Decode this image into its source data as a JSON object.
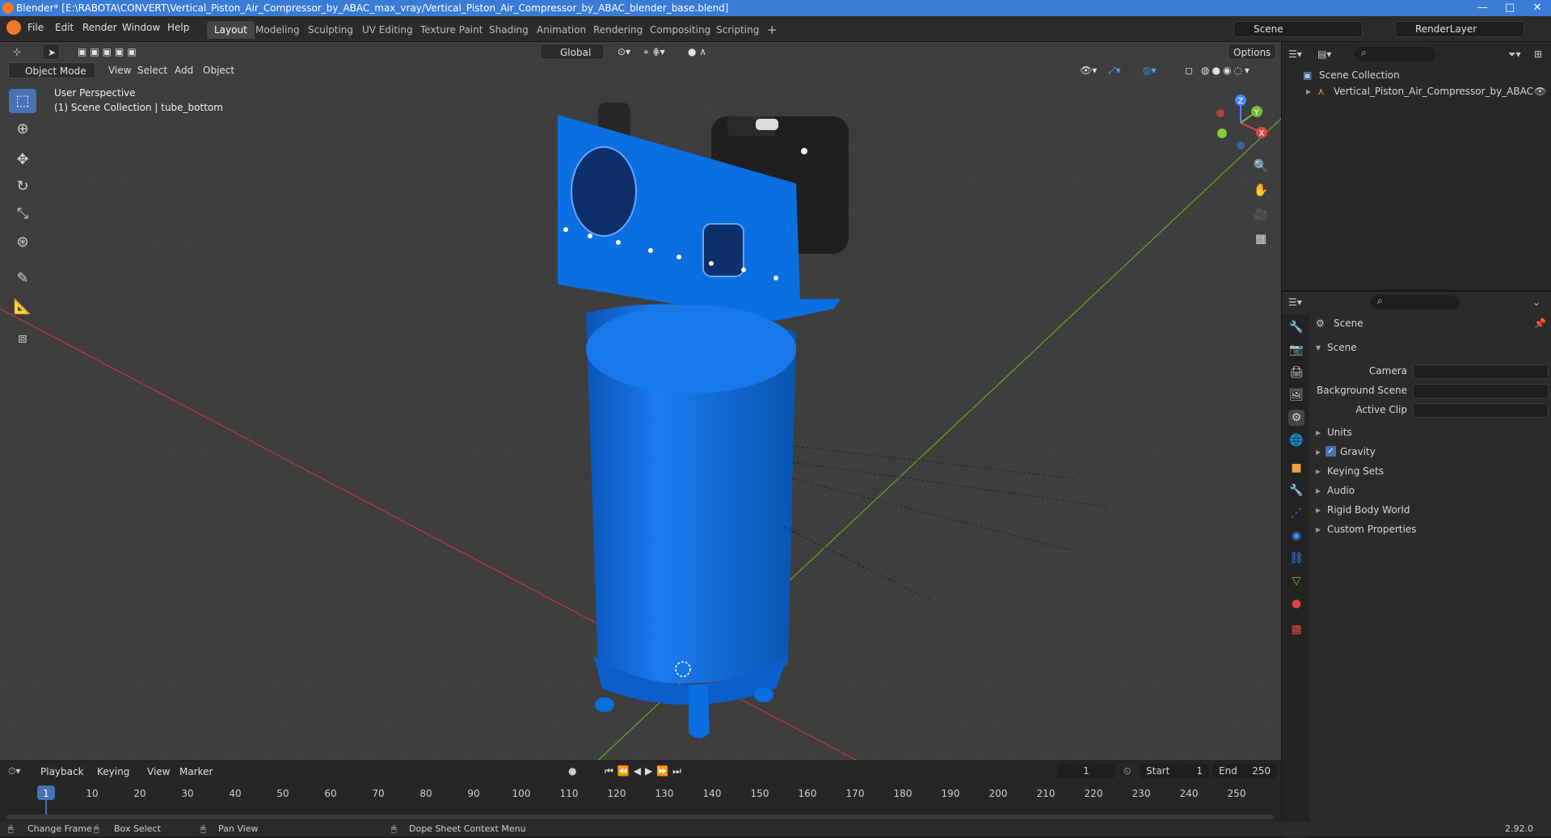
{
  "window": {
    "title": "Blender* [E:\\RABOTA\\CONVERT\\Vertical_Piston_Air_Compressor_by_ABAC_max_vray/Vertical_Piston_Air_Compressor_by_ABAC_blender_base.blend]",
    "controls": [
      "—",
      "□",
      "✕"
    ]
  },
  "menubar": {
    "menus": [
      "File",
      "Edit",
      "Render",
      "Window",
      "Help"
    ],
    "workspaces": [
      "Layout",
      "Modeling",
      "Sculpting",
      "UV Editing",
      "Texture Paint",
      "Shading",
      "Animation",
      "Rendering",
      "Compositing",
      "Scripting"
    ],
    "active_workspace": "Layout",
    "add_workspace": "+",
    "scene": "Scene",
    "view_layer": "RenderLayer"
  },
  "viewport": {
    "mode": "Object Mode",
    "menus": [
      "View",
      "Select",
      "Add",
      "Object"
    ],
    "transform_orientation": "Global",
    "options": "Options",
    "info_line1": "User Perspective",
    "info_line2": "(1) Scene Collection | tube_bottom",
    "gizmo_axes": [
      "X",
      "Y",
      "Z"
    ]
  },
  "outliner": {
    "root": "Scene Collection",
    "items": [
      "Vertical_Piston_Air_Compressor_by_ABAC"
    ]
  },
  "properties": {
    "context_title": "Scene",
    "section": "Scene",
    "fields": [
      {
        "label": "Camera",
        "value": ""
      },
      {
        "label": "Background Scene",
        "value": ""
      },
      {
        "label": "Active Clip",
        "value": ""
      }
    ],
    "panels": [
      {
        "label": "Units",
        "checkbox": false
      },
      {
        "label": "Gravity",
        "checkbox": true
      },
      {
        "label": "Keying Sets",
        "checkbox": false
      },
      {
        "label": "Audio",
        "checkbox": false
      },
      {
        "label": "Rigid Body World",
        "checkbox": false
      },
      {
        "label": "Custom Properties",
        "checkbox": false
      }
    ]
  },
  "timeline": {
    "menus": [
      "Playback",
      "Keying",
      "View",
      "Marker"
    ],
    "current_frame": "1",
    "start_label": "Start",
    "start": "1",
    "end_label": "End",
    "end": "250",
    "ticks": [
      "1",
      "10",
      "20",
      "30",
      "40",
      "50",
      "60",
      "70",
      "80",
      "90",
      "100",
      "110",
      "120",
      "130",
      "140",
      "150",
      "160",
      "170",
      "180",
      "190",
      "200",
      "210",
      "220",
      "230",
      "240",
      "250"
    ]
  },
  "statusbar": {
    "items": [
      "Change Frame",
      "Box Select",
      "Pan View",
      "Dope Sheet Context Menu"
    ],
    "version": "2.92.0"
  },
  "colors": {
    "accent": "#4772b3",
    "compressor_blue": "#0a6fe0",
    "x_axis": "#b8343c",
    "y_axis": "#6a9a2a"
  }
}
